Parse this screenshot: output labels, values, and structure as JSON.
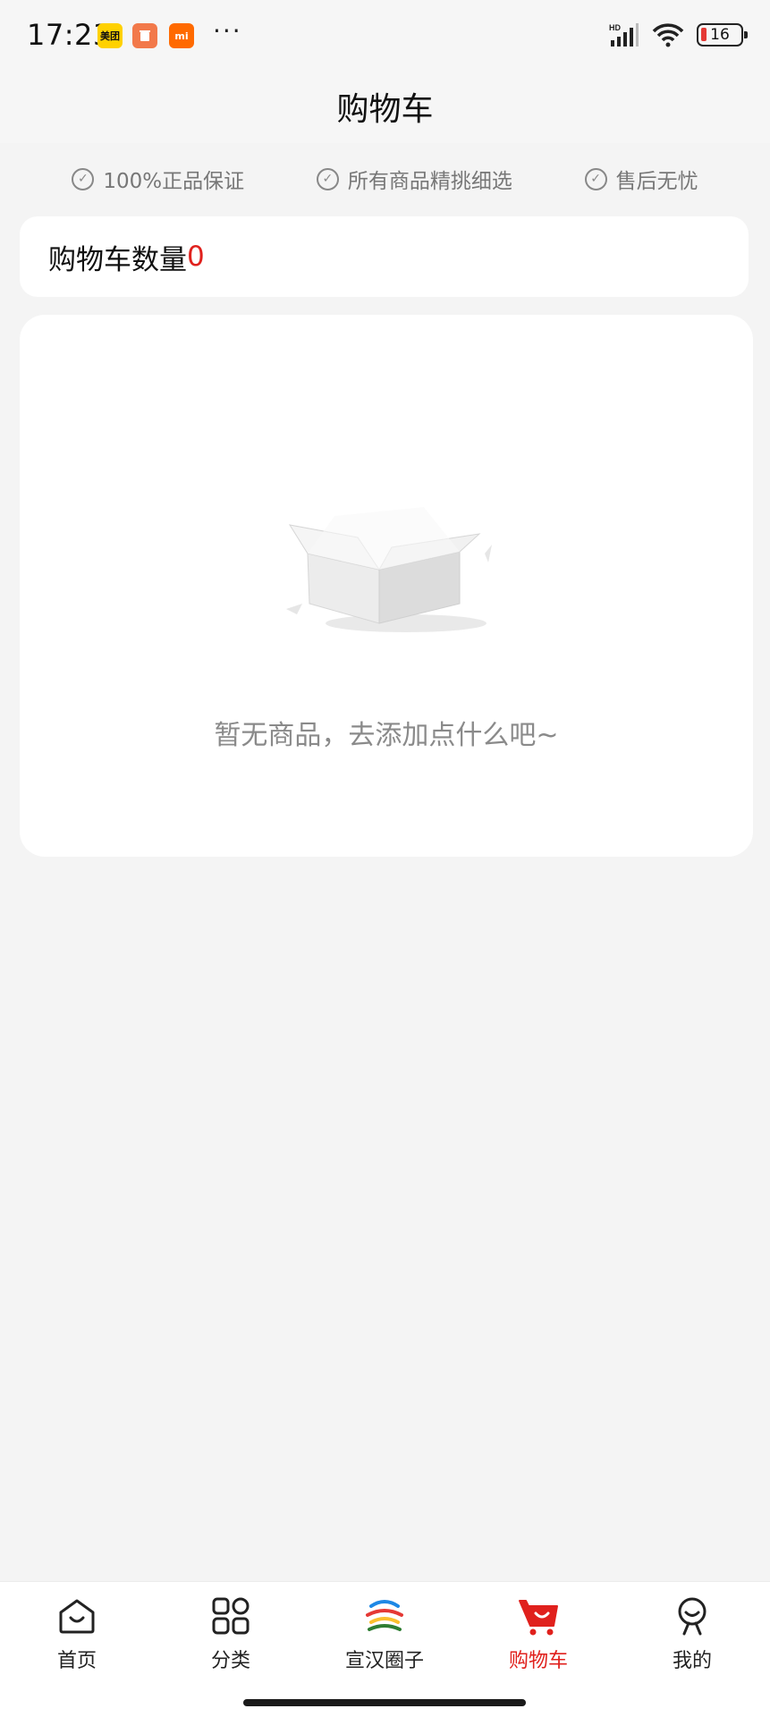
{
  "status_bar": {
    "time": "17:23",
    "badges": [
      "美团",
      "",
      "mi"
    ],
    "more": "···",
    "battery": "16",
    "signal_label": "HD"
  },
  "header": {
    "title": "购物车"
  },
  "guarantees": [
    {
      "icon": "check-circle-icon",
      "label": "100%正品保证"
    },
    {
      "icon": "check-circle-icon",
      "label": "所有商品精挑细选"
    },
    {
      "icon": "check-circle-icon",
      "label": "售后无忧"
    }
  ],
  "cart": {
    "count_label": "购物车数量",
    "count": "0"
  },
  "empty": {
    "message": "暂无商品，去添加点什么吧~"
  },
  "tabs": [
    {
      "label": "首页",
      "icon": "home-icon",
      "active": false
    },
    {
      "label": "分类",
      "icon": "category-icon",
      "active": false
    },
    {
      "label": "宣汉圈子",
      "icon": "circle-logo-icon",
      "active": false
    },
    {
      "label": "购物车",
      "icon": "cart-icon",
      "active": true
    },
    {
      "label": "我的",
      "icon": "profile-icon",
      "active": false
    }
  ],
  "colors": {
    "accent": "#e0211d",
    "background": "#f4f4f4"
  }
}
